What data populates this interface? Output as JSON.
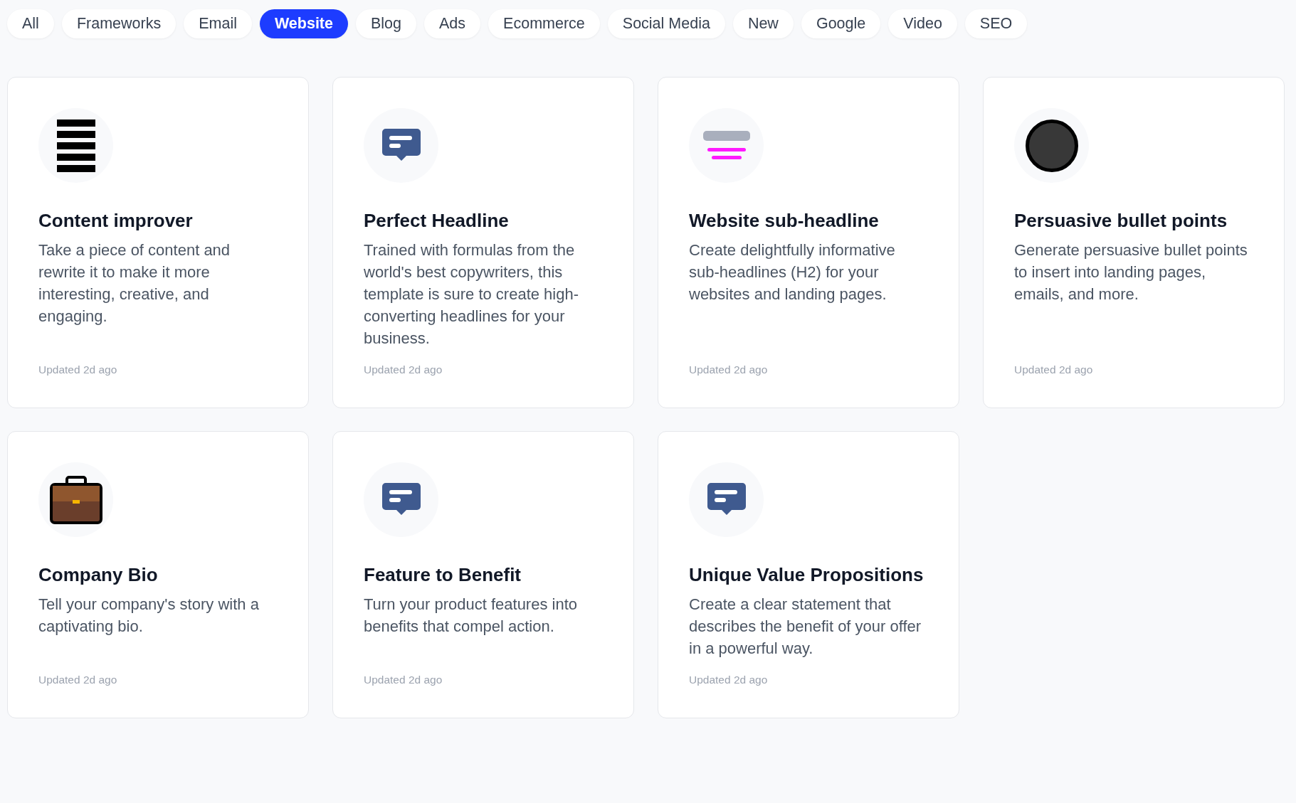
{
  "tabs": [
    {
      "label": "All",
      "selected": false
    },
    {
      "label": "Frameworks",
      "selected": false
    },
    {
      "label": "Email",
      "selected": false
    },
    {
      "label": "Website",
      "selected": true
    },
    {
      "label": "Blog",
      "selected": false
    },
    {
      "label": "Ads",
      "selected": false
    },
    {
      "label": "Ecommerce",
      "selected": false
    },
    {
      "label": "Social Media",
      "selected": false
    },
    {
      "label": "New",
      "selected": false
    },
    {
      "label": "Google",
      "selected": false
    },
    {
      "label": "Video",
      "selected": false
    },
    {
      "label": "SEO",
      "selected": false
    }
  ],
  "cards": [
    {
      "kind": "lines",
      "title": "Content improver",
      "description": "Take a piece of content and rewrite it to make it more interesting, creative, and engaging.",
      "updated": "Updated 2d ago"
    },
    {
      "kind": "chat",
      "title": "Perfect Headline",
      "description": "Trained with formulas from the world's best copywriters, this template is sure to create high-converting headlines for your business.",
      "updated": "Updated 2d ago"
    },
    {
      "kind": "subheadline",
      "title": "Website sub-headline",
      "description": "Create delightfully informative sub-headlines (H2) for your websites and landing pages.",
      "updated": "Updated 2d ago"
    },
    {
      "kind": "circle",
      "title": "Persuasive bullet points",
      "description": "Generate persuasive bullet points to insert into landing pages, emails, and more.",
      "updated": "Updated 2d ago"
    },
    {
      "kind": "briefcase",
      "title": "Company Bio",
      "description": "Tell your company's story with a captivating bio.",
      "updated": "Updated 2d ago"
    },
    {
      "kind": "chat",
      "title": "Feature to Benefit",
      "description": "Turn your product features into benefits that compel action.",
      "updated": "Updated 2d ago"
    },
    {
      "kind": "chat",
      "title": "Unique Value Propositions",
      "description": "Create a clear statement that describes the benefit of your offer in a powerful way.",
      "updated": "Updated 2d ago"
    }
  ]
}
